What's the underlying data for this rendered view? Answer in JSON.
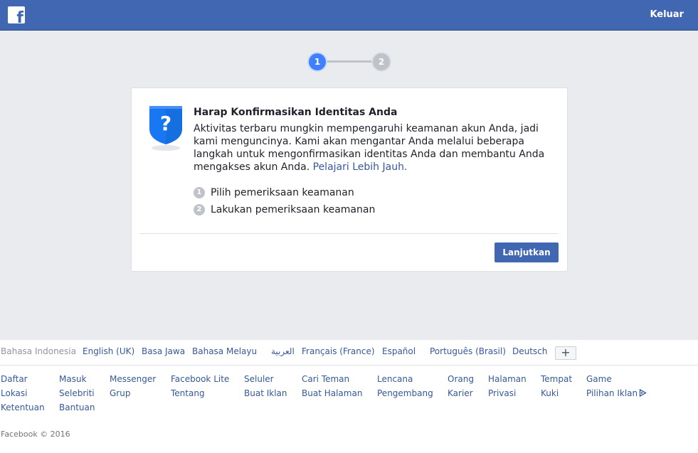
{
  "header": {
    "logo_letter": "f",
    "logout_label": "Keluar"
  },
  "stepper": {
    "step1": "1",
    "step2": "2"
  },
  "card": {
    "title": "Harap Konfirmasikan Identitas Anda",
    "description": "Aktivitas terbaru mungkin mempengaruhi keamanan akun Anda, jadi kami menguncinya. Kami akan mengantar Anda melalui beberapa langkah untuk mengonfirmasikan identitas Anda dan membantu Anda mengakses akun Anda.",
    "learn_more": "Pelajari Lebih Jauh.",
    "steps": [
      {
        "num": "1",
        "label": "Pilih pemeriksaan keamanan"
      },
      {
        "num": "2",
        "label": "Lakukan pemeriksaan keamanan"
      }
    ],
    "continue_label": "Lanjutkan"
  },
  "footer": {
    "languages": [
      "Bahasa Indonesia",
      "English (UK)",
      "Basa Jawa",
      "Bahasa Melayu",
      "العربية",
      "Français (France)",
      "Español",
      "Português (Brasil)",
      "Deutsch"
    ],
    "more_languages": "+",
    "links_row1": [
      "Daftar",
      "Masuk",
      "Messenger",
      "Facebook Lite",
      "Seluler",
      "Cari Teman",
      "Lencana",
      "Orang",
      "Halaman",
      "Tempat",
      "Game"
    ],
    "links_row2": [
      "Lokasi",
      "Selebriti",
      "Grup",
      "Tentang",
      "Buat Iklan",
      "Buat Halaman",
      "Pengembang",
      "Karier",
      "Privasi",
      "Kuki",
      "Pilihan Iklan"
    ],
    "links_row3": [
      "Ketentuan",
      "Bantuan"
    ],
    "copyright": "Facebook © 2016"
  },
  "colors": {
    "brand": "#4267b2",
    "link": "#365899",
    "step_active": "#4080ff"
  }
}
